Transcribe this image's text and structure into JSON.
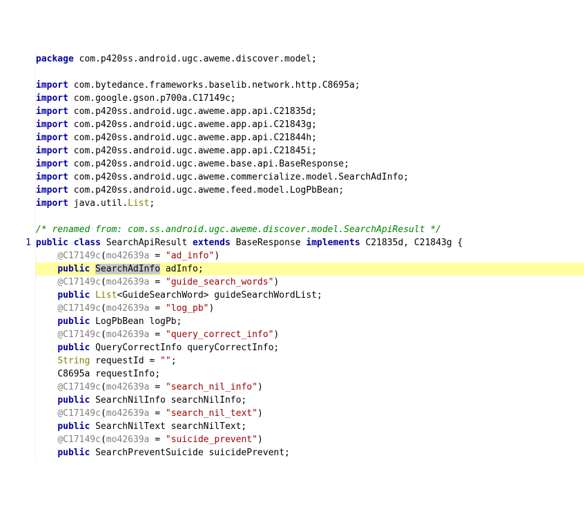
{
  "package_kw": "package",
  "package_name": " com.p420ss.android.ugc.aweme.discover.model",
  "import_kw": "import",
  "imports": [
    " com.bytedance.frameworks.baselib.network.http.C8695a",
    " com.google.gson.p700a.C17149c",
    " com.p420ss.android.ugc.aweme.app.api.C21835d",
    " com.p420ss.android.ugc.aweme.app.api.C21843g",
    " com.p420ss.android.ugc.aweme.app.api.C21844h",
    " com.p420ss.android.ugc.aweme.app.api.C21845i",
    " com.p420ss.android.ugc.aweme.base.api.BaseResponse",
    " com.p420ss.android.ugc.aweme.commercialize.model.SearchAdInfo",
    " com.p420ss.android.ugc.aweme.feed.model.LogPbBean",
    " java.util."
  ],
  "import_list_type": "List",
  "rename_comment": "/* renamed from: com.ss.android.ugc.aweme.discover.model.SearchApiResult */",
  "decl": {
    "public": "public",
    "class": "class",
    "name": " SearchApiResult ",
    "extends": "extends",
    "base": " BaseResponse ",
    "implements": "implements",
    "ifaces": " C21835d, C21843g ",
    "brace": "{"
  },
  "ann_name": "@C17149c",
  "ann_arg": "mo42639a",
  "eq": " = ",
  "gutter_link": "1",
  "members": [
    {
      "ann_str": "\"ad_info\"",
      "is_hl": true,
      "decl_pre": "",
      "decl_mid_sel": "SearchAdInfo",
      "decl_post": " adInfo;"
    },
    {
      "ann_str": "\"guide_search_words\"",
      "is_hl": false,
      "decl": "List",
      "decl_generic": "<GuideSearchWord> guideSearchWordList;"
    },
    {
      "ann_str": "\"log_pb\"",
      "is_hl": false,
      "decl_plain": "LogPbBean logPb;"
    },
    {
      "ann_str": "\"query_correct_info\"",
      "is_hl": false,
      "decl_plain": "QueryCorrectInfo queryCorrectInfo;"
    },
    {
      "no_ann": true,
      "string_decl": true,
      "type": "String",
      "rest": " requestId = ",
      "val": "\"\"",
      "end": ";"
    },
    {
      "no_ann": true,
      "plain_decl": "C8695a requestInfo;"
    },
    {
      "ann_str": "\"search_nil_info\"",
      "is_hl": false,
      "decl_plain": "SearchNilInfo searchNilInfo;"
    },
    {
      "ann_str": "\"search_nil_text\"",
      "is_hl": false,
      "decl_plain": "SearchNilText searchNilText;"
    },
    {
      "ann_str": "\"suicide_prevent\"",
      "is_hl": false,
      "decl_plain": "SearchPreventSuicide suicidePrevent;"
    }
  ],
  "public_kw": "public"
}
